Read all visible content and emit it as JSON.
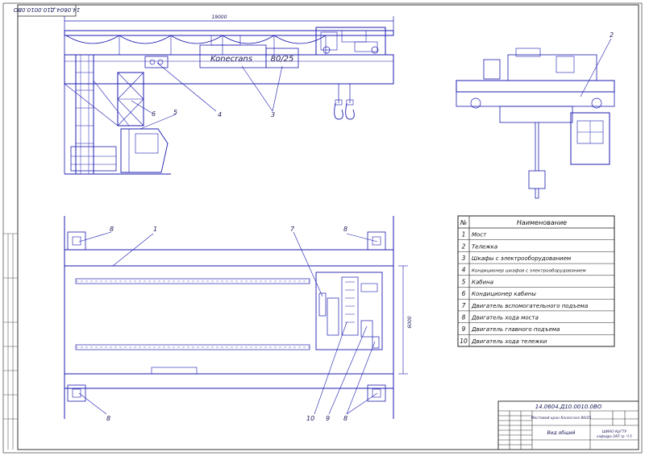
{
  "drawing": {
    "stamp_top": "14.0604.Д10.0010.0ВО",
    "stamp_bottom": "14.0604.Д10.0010.0ВО",
    "dim_span": "19000",
    "dim_width": "6000",
    "brand": "Konecrans",
    "capacity": "80/25",
    "title_line1": "Мостовой кран Konecrans 80/25",
    "title_line2": "Вид общий",
    "org_line1": "ШИАО КрГТУ",
    "org_line2": "кафедра ЭАП гр. Ч-5",
    "callouts": {
      "c1": "1",
      "c2": "2",
      "c3": "3",
      "c4": "4",
      "c5": "5",
      "c6": "6",
      "c7": "7",
      "c8a": "8",
      "c8b": "8",
      "c8c": "8",
      "c9": "9",
      "c10": "10"
    }
  },
  "legend": {
    "header_num": "№",
    "header_name": "Наименование",
    "rows": [
      {
        "num": "1",
        "name": "Мост"
      },
      {
        "num": "2",
        "name": "Тележка"
      },
      {
        "num": "3",
        "name": "Шкафы с электрооборудованием"
      },
      {
        "num": "4",
        "name": "Кондиционер шкафов с электрооборудованием"
      },
      {
        "num": "5",
        "name": "Кабина"
      },
      {
        "num": "6",
        "name": "Кондиционер кабины"
      },
      {
        "num": "7",
        "name": "Двигатель вспомогательного подъема"
      },
      {
        "num": "8",
        "name": "Двигатель хода моста"
      },
      {
        "num": "9",
        "name": "Двигатель главного подъема"
      },
      {
        "num": "10",
        "name": "Двигатель хода тележки"
      }
    ]
  },
  "colors": {
    "line": "#1c1cb0",
    "legend": "#222222",
    "frame": "#333333"
  }
}
